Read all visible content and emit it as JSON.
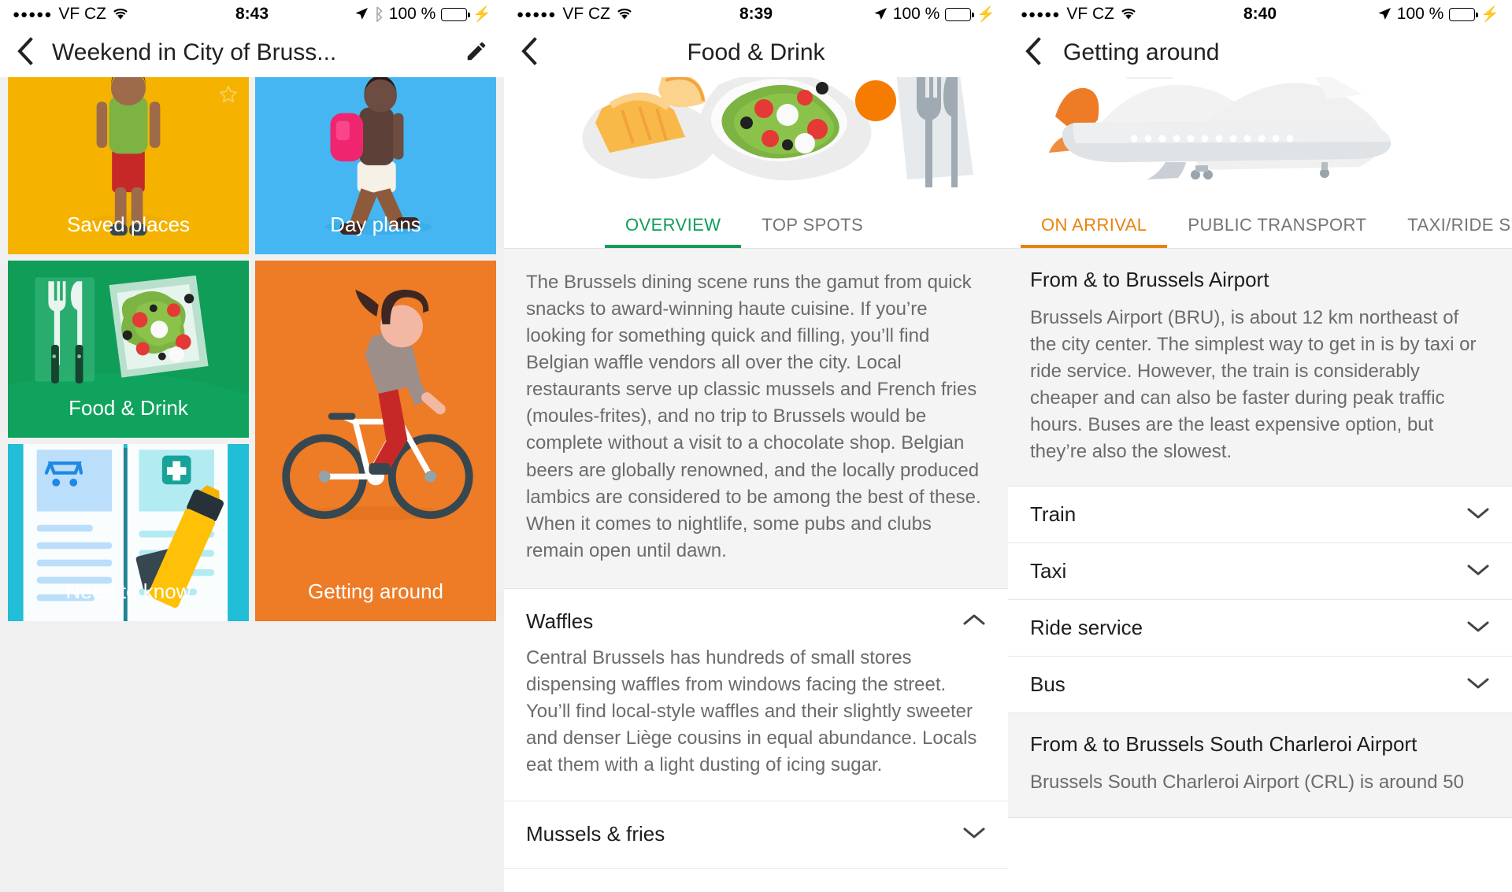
{
  "panels": [
    {
      "status": {
        "signal_dots": "●●●●●",
        "carrier": "VF CZ",
        "wifi_icon": "wifi-icon",
        "time": "8:43",
        "location_icon": "location-arrow-icon",
        "bluetooth_icon": "bluetooth-icon",
        "battery_percent": "100 %",
        "charging_icon": "lightning-bolt-icon"
      },
      "nav": {
        "back_icon": "back-chevron-icon",
        "title": "Weekend in City of Bruss...",
        "edit_icon": "pencil-edit-icon"
      },
      "tiles": [
        {
          "label": "Saved places",
          "color": "#F5B300",
          "art": "person-standing",
          "starred": true
        },
        {
          "label": "Day plans",
          "color": "#45B6F2",
          "art": "person-walking-backpack",
          "starred": false
        },
        {
          "label": "Food & Drink",
          "color": "#0F9D58",
          "art": "salad-cutlery",
          "starred": false
        },
        {
          "label": "Getting around",
          "color": "#EE7B26",
          "art": "person-cycling",
          "starred": false
        },
        {
          "label": "Need to know",
          "color": "#22BDD6",
          "art": "open-book-highlighter",
          "starred": false
        }
      ]
    },
    {
      "status": {
        "signal_dots": "●●●●●",
        "carrier": "VF CZ",
        "wifi_icon": "wifi-icon",
        "time": "8:39",
        "location_icon": "location-arrow-icon",
        "bluetooth_icon": "",
        "battery_percent": "100 %",
        "charging_icon": "lightning-bolt-icon"
      },
      "nav": {
        "back_icon": "back-chevron-icon",
        "title": "Food & Drink",
        "edit_icon": ""
      },
      "accent": "#0F9D58",
      "hero_art": "food-drink-hero",
      "tabs": [
        {
          "label": "OVERVIEW",
          "active": true
        },
        {
          "label": "TOP SPOTS",
          "active": false
        }
      ],
      "blurb": "The Brussels dining scene runs the gamut from quick snacks to award-winning haute cuisine. If you’re looking for something quick and filling, you’ll find Belgian waffle vendors all over the city. Local restaurants serve up classic mussels and French fries (moules-frites), and no trip to Brussels would be complete without a visit to a chocolate shop. Belgian beers are globally renowned, and the locally produced lambics are considered to be among the best of these. When it comes to nightlife, some pubs and clubs remain open until dawn.",
      "accordion": [
        {
          "title": "Waffles",
          "expanded": true,
          "chevron": "chevron-up-icon",
          "body": "Central Brussels has hundreds of small stores dispensing waffles from windows facing the street. You’ll find local-style waffles and their slightly sweeter and denser Liège cousins in equal abundance. Locals eat them with a light dusting of icing sugar."
        },
        {
          "title": "Mussels & fries",
          "expanded": false,
          "chevron": "chevron-down-icon",
          "body": ""
        }
      ]
    },
    {
      "status": {
        "signal_dots": "●●●●●",
        "carrier": "VF CZ",
        "wifi_icon": "wifi-icon",
        "time": "8:40",
        "location_icon": "location-arrow-icon",
        "bluetooth_icon": "",
        "battery_percent": "100 %",
        "charging_icon": "lightning-bolt-icon"
      },
      "nav": {
        "back_icon": "back-chevron-icon",
        "title": "Getting around",
        "edit_icon": ""
      },
      "accent": "#E8820C",
      "hero_art": "airplane-hero",
      "tabs": [
        {
          "label": "ON ARRIVAL",
          "active": true
        },
        {
          "label": "PUBLIC TRANSPORT",
          "active": false
        },
        {
          "label": "TAXI/RIDE SE",
          "active": false
        }
      ],
      "section_title": "From & to Brussels Airport",
      "section_body": "Brussels Airport (BRU), is about 12 km northeast of the city center. The simplest way to get in is by taxi or ride service. However, the train is considerably cheaper and can also be faster during peak traffic hours. Buses are the least expensive option, but they’re also the slowest.",
      "rows": [
        {
          "label": "Train",
          "chevron": "chevron-down-icon"
        },
        {
          "label": "Taxi",
          "chevron": "chevron-down-icon"
        },
        {
          "label": "Ride service",
          "chevron": "chevron-down-icon"
        },
        {
          "label": "Bus",
          "chevron": "chevron-down-icon"
        }
      ],
      "section2_title": "From & to Brussels South Charleroi Airport",
      "section2_body": "Brussels South Charleroi Airport (CRL) is around 50"
    }
  ]
}
